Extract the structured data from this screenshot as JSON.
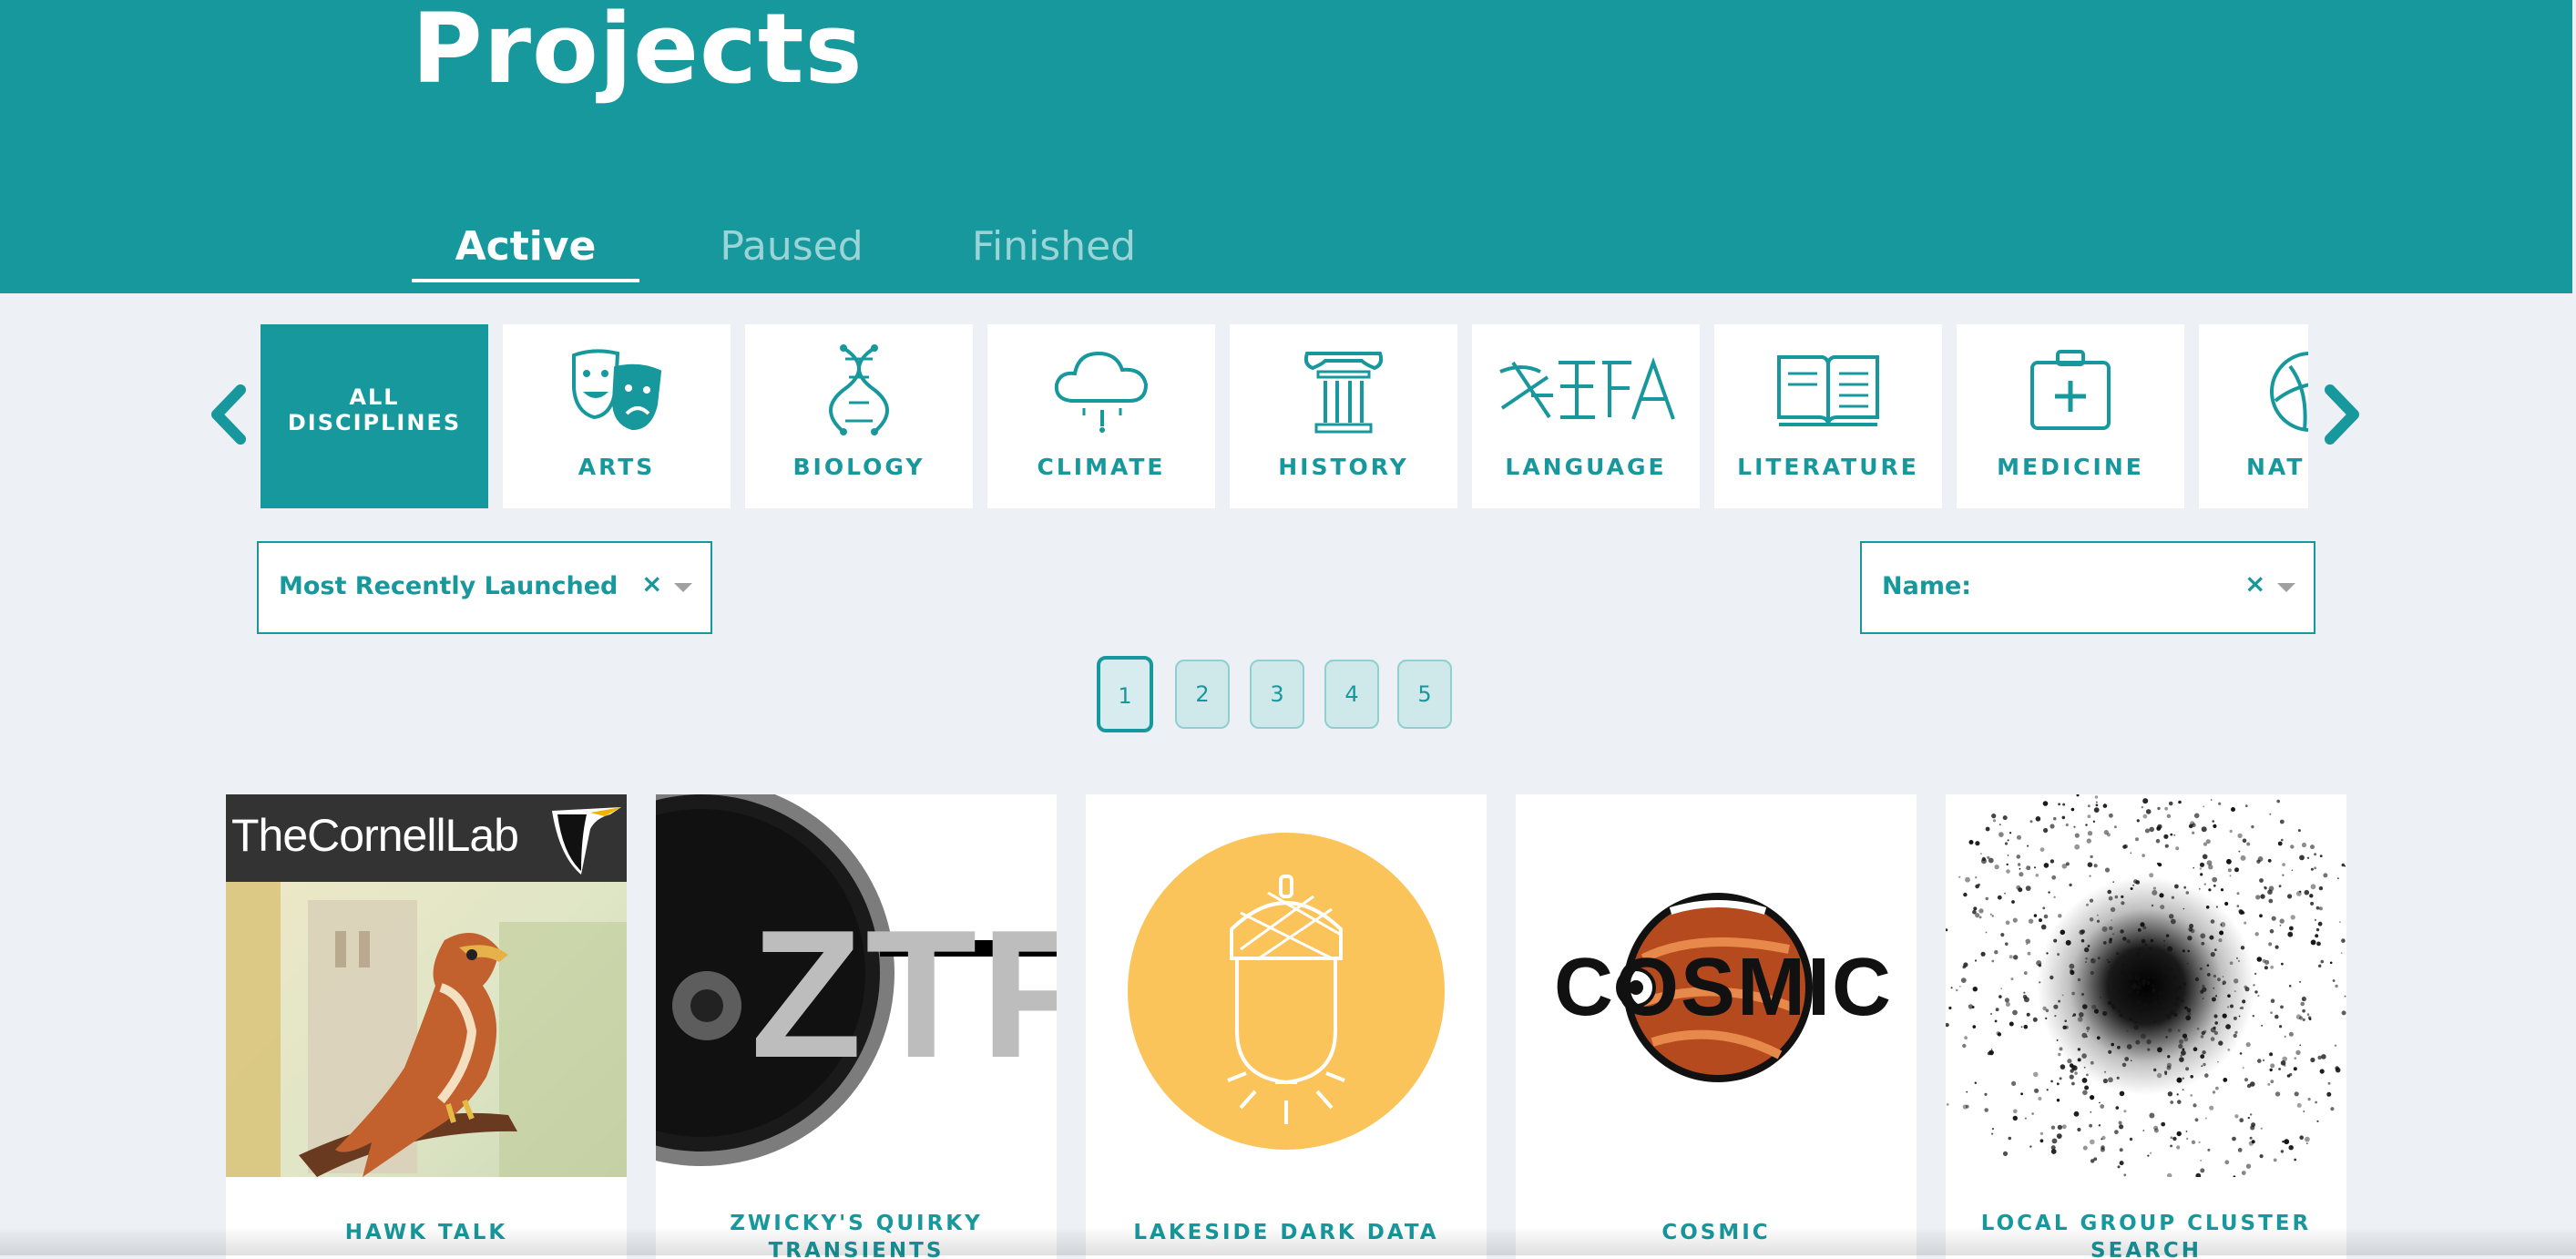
{
  "header": {
    "title": "Projects"
  },
  "tabs": [
    {
      "label": "Active",
      "active": true
    },
    {
      "label": "Paused",
      "active": false
    },
    {
      "label": "Finished",
      "active": false
    }
  ],
  "disciplines": [
    {
      "label": "ALL DISCIPLINES",
      "line1": "ALL",
      "line2": "DISCIPLINES",
      "icon": "none",
      "active": true
    },
    {
      "label": "ARTS",
      "icon": "theater-masks-icon"
    },
    {
      "label": "BIOLOGY",
      "icon": "dna-icon"
    },
    {
      "label": "CLIMATE",
      "icon": "rain-cloud-icon"
    },
    {
      "label": "HISTORY",
      "icon": "column-icon"
    },
    {
      "label": "LANGUAGE",
      "icon": "letters-icon"
    },
    {
      "label": "LITERATURE",
      "icon": "open-book-icon"
    },
    {
      "label": "MEDICINE",
      "icon": "medical-kit-icon"
    },
    {
      "label": "NAT",
      "icon": "globe-icon"
    }
  ],
  "sort_select": {
    "value": "Most Recently Launched",
    "clear": "×"
  },
  "name_select": {
    "value": "Name:",
    "clear": "×"
  },
  "pagination": {
    "pages": [
      "1",
      "2",
      "3",
      "4",
      "5"
    ],
    "current": "1"
  },
  "projects": [
    {
      "name": "HAWK TALK",
      "logo_text": "TheCornellLab"
    },
    {
      "name": "ZWICKY'S QUIRKY TRANSIENTS",
      "logo_text": "ZTF"
    },
    {
      "name": "LAKESIDE DARK DATA"
    },
    {
      "name": "COSMIC",
      "logo_text": "COSMIC"
    },
    {
      "name": "LOCAL GROUP CLUSTER SEARCH"
    }
  ],
  "colors": {
    "teal": "#17989d",
    "background": "#edf0f4",
    "acorn_yellow": "#fbc45a"
  }
}
